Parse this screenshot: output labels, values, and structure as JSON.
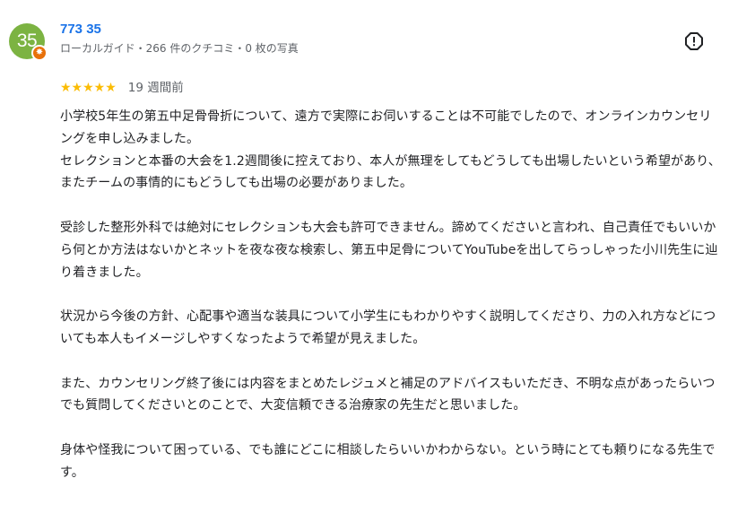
{
  "author": {
    "avatar_text": "35",
    "name": "773 35",
    "meta": "ローカルガイド・266 件のクチコミ・0 枚の写真"
  },
  "rating": {
    "stars_text": "★★★★★",
    "value": 5,
    "max": 5,
    "time_ago": "19 週間前"
  },
  "icons": {
    "avatar_badge": "local-guide-star-icon",
    "report": "report-flag-icon"
  },
  "colors": {
    "avatar_bg": "#7cb342",
    "badge_bg": "#e8710a",
    "name": "#1a73e8",
    "stars": "#fbbc04",
    "meta": "#5f6368"
  },
  "review": {
    "paragraphs": [
      "小学校5年生の第五中足骨骨折について、遠方で実際にお伺いすることは不可能でしたので、オンラインカウンセリングを申し込みました。\nセレクションと本番の大会を1.2週間後に控えており、本人が無理をしてもどうしても出場したいという希望があり、またチームの事情的にもどうしても出場の必要がありました。",
      "受診した整形外科では絶対にセレクションも大会も許可できません。諦めてくださいと言われ、自己責任でもいいから何とか方法はないかとネットを夜な夜な検索し、第五中足骨についてYouTubeを出してらっしゃった小川先生に辿り着きました。",
      "状況から今後の方針、心配事や適当な装具について小学生にもわかりやすく説明してくださり、力の入れ方などについても本人もイメージしやすくなったようで希望が見えました。",
      "また、カウンセリング終了後には内容をまとめたレジュメと補足のアドバイスもいただき、不明な点があったらいつでも質問してくださいとのことで、大変信頼できる治療家の先生だと思いました。",
      "身体や怪我について困っている、でも誰にどこに相談したらいいかわからない。という時にとても頼りになる先生です。"
    ]
  }
}
